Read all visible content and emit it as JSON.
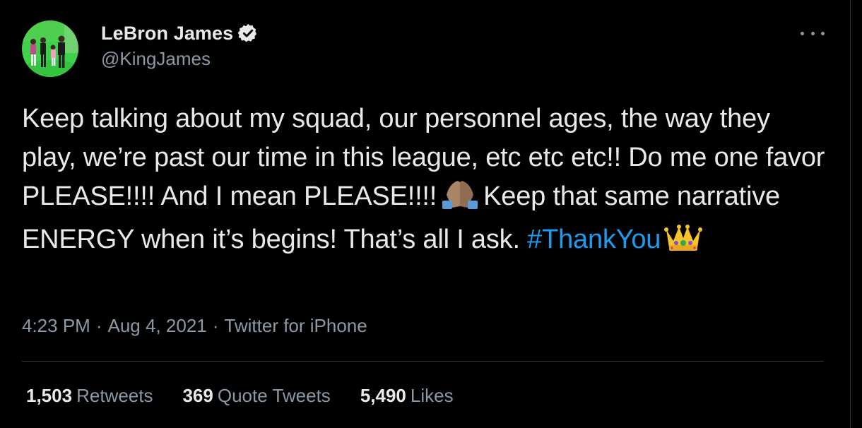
{
  "author": {
    "display_name": "LeBron James",
    "handle": "@KingJames",
    "verified": true
  },
  "tweet": {
    "text_parts": {
      "p1": "Keep talking about my squad, our personnel ages, the way they play, we’re past our time in this league, etc etc etc!! Do me one favor PLEASE!!!! And I mean PLEASE!!!!",
      "p2": "Keep that same narrative ENERGY when it’s begins! That’s all I ask.",
      "hashtag": "#ThankYou"
    },
    "emojis": [
      "folded-hands",
      "crown"
    ]
  },
  "meta": {
    "time": "4:23 PM",
    "separator": "·",
    "date": "Aug 4, 2021",
    "source": "Twitter for iPhone"
  },
  "stats": {
    "retweets": {
      "count": "1,503",
      "label": "Retweets"
    },
    "quotes": {
      "count": "369",
      "label": "Quote Tweets"
    },
    "likes": {
      "count": "5,490",
      "label": "Likes"
    }
  },
  "colors": {
    "background": "#000000",
    "text": "#e7e9ea",
    "secondary": "#8b98a5",
    "link": "#1d9bf0",
    "border": "#2f3336"
  }
}
